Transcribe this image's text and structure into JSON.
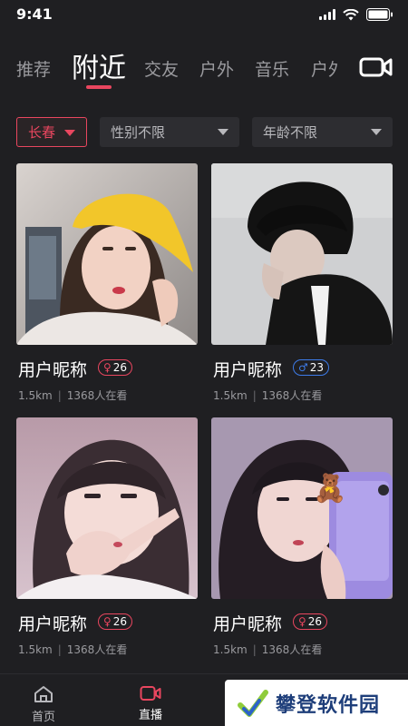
{
  "status_bar": {
    "time": "9:41"
  },
  "tabs": [
    {
      "label": "推荐",
      "active": false
    },
    {
      "label": "附近",
      "active": true
    },
    {
      "label": "交友",
      "active": false
    },
    {
      "label": "户外",
      "active": false
    },
    {
      "label": "音乐",
      "active": false
    },
    {
      "label": "户外",
      "active": false
    }
  ],
  "camera_icon": "video-camera-icon",
  "filters": {
    "city": "长春",
    "gender": "性别不限",
    "age": "年龄不限"
  },
  "cards": [
    {
      "name": "用户昵称",
      "gender": "female",
      "gender_symbol": "♀",
      "age": "26",
      "distance": "1.5km",
      "separator": "|",
      "viewers": "1368人在看"
    },
    {
      "name": "用户昵称",
      "gender": "male",
      "gender_symbol": "♂",
      "age": "23",
      "distance": "1.5km",
      "separator": "|",
      "viewers": "1368人在看"
    },
    {
      "name": "用户昵称",
      "gender": "female",
      "gender_symbol": "♀",
      "age": "26",
      "distance": "1.5km",
      "separator": "|",
      "viewers": "1368人在看"
    },
    {
      "name": "用户昵称",
      "gender": "female",
      "gender_symbol": "♀",
      "age": "26",
      "distance": "1.5km",
      "separator": "|",
      "viewers": "1368人在看"
    }
  ],
  "bottom_nav": [
    {
      "label": "首页",
      "icon": "home-icon",
      "active": false
    },
    {
      "label": "直播",
      "icon": "live-video-icon",
      "active": true
    }
  ],
  "watermark": {
    "text": "攀登软件园"
  },
  "colors": {
    "accent": "#e9465f",
    "male": "#3d7be8",
    "background": "#1f1f22"
  }
}
